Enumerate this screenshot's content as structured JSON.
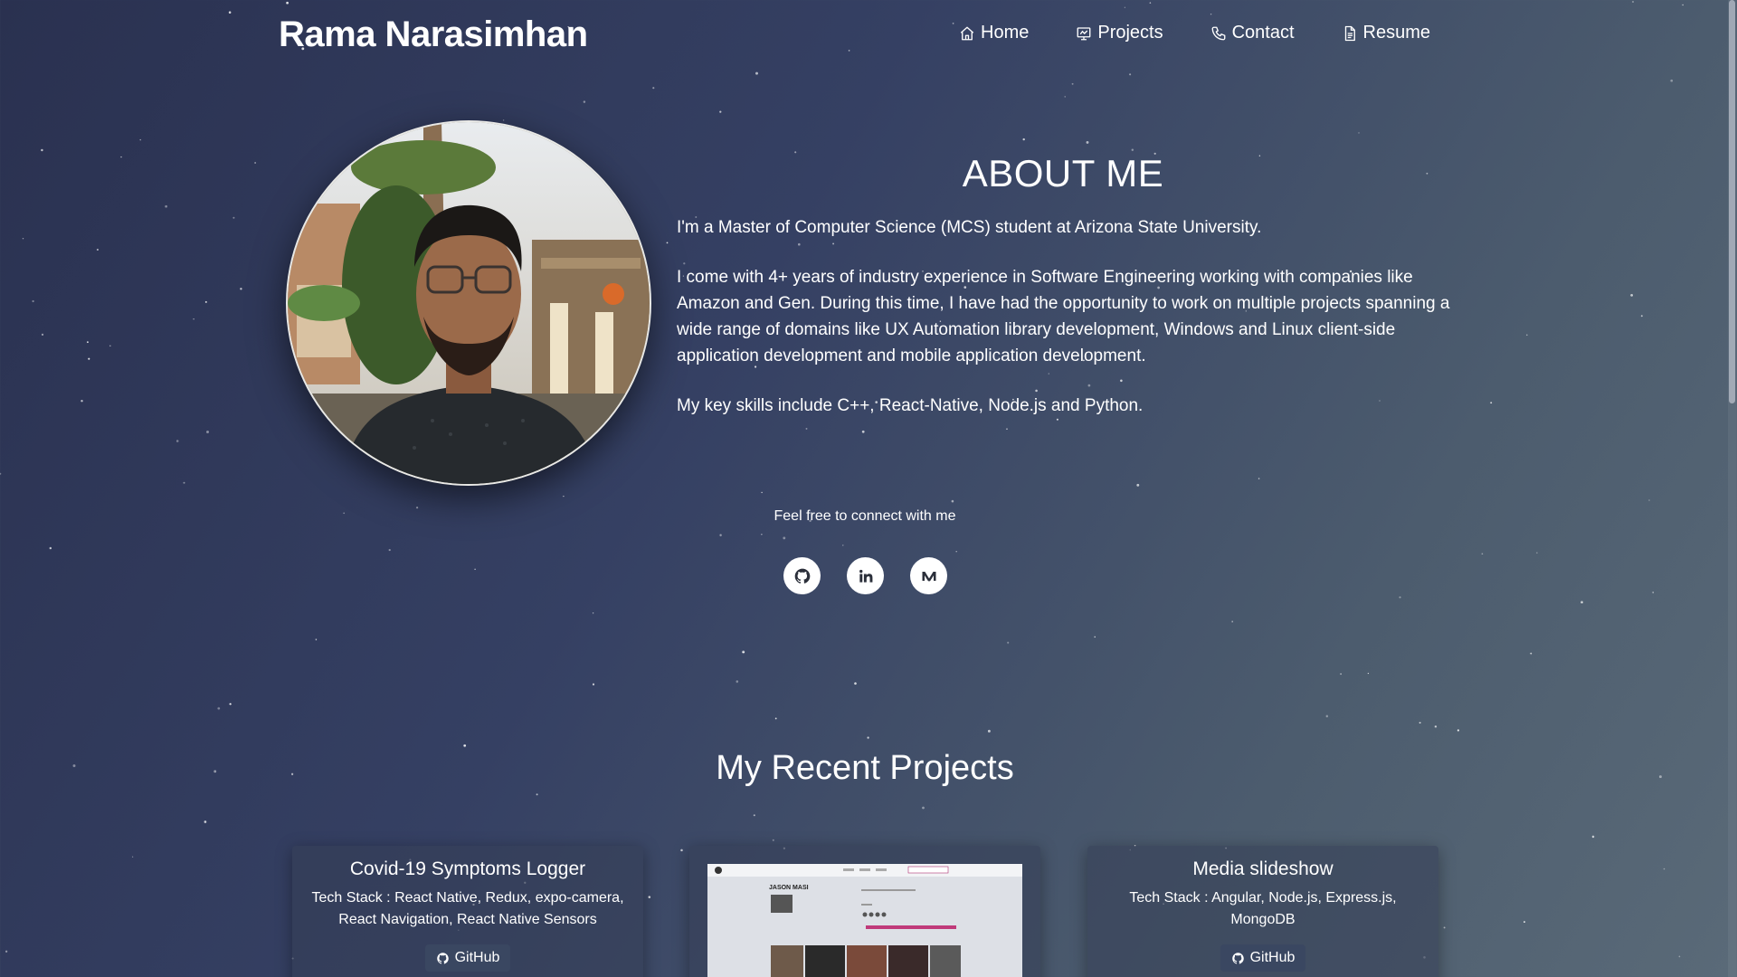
{
  "header": {
    "brand": "Rama Narasimhan",
    "nav": [
      {
        "label": "Home",
        "icon": "home-icon"
      },
      {
        "label": "Projects",
        "icon": "projects-icon"
      },
      {
        "label": "Contact",
        "icon": "phone-icon"
      },
      {
        "label": "Resume",
        "icon": "document-icon"
      }
    ]
  },
  "about": {
    "title": "ABOUT ME",
    "paragraphs": [
      "I'm a Master of Computer Science (MCS) student at Arizona State University.",
      "I come with 4+ years of industry experience in Software Engineering working with companies like Amazon and Gen. During this time, I have had the opportunity to work on multiple projects spanning a wide range of domains like UX Automation library development, Windows and Linux client-side application development and mobile application development.",
      "My key skills include C++, React-Native, Node.js and Python."
    ]
  },
  "connect": {
    "text": "Feel free to connect with me",
    "socials": [
      "github-icon",
      "linkedin-icon",
      "medium-icon"
    ]
  },
  "projects": {
    "title": "My Recent Projects",
    "cards": [
      {
        "title": "Covid-19 Symptoms Logger",
        "stack": "Tech Stack : React Native, Redux, expo-camera, React Navigation, React Native Sensors",
        "button": "GitHub"
      },
      {
        "preview_heading": "JASON MASI"
      },
      {
        "title": "Media slideshow",
        "stack": "Tech Stack : Angular, Node.js, Express.js, MongoDB",
        "button": "GitHub"
      }
    ]
  },
  "colors": {
    "background_start": "#2a3150",
    "background_end": "#5a6a78",
    "card": "#343e56",
    "button": "#3a4761"
  }
}
